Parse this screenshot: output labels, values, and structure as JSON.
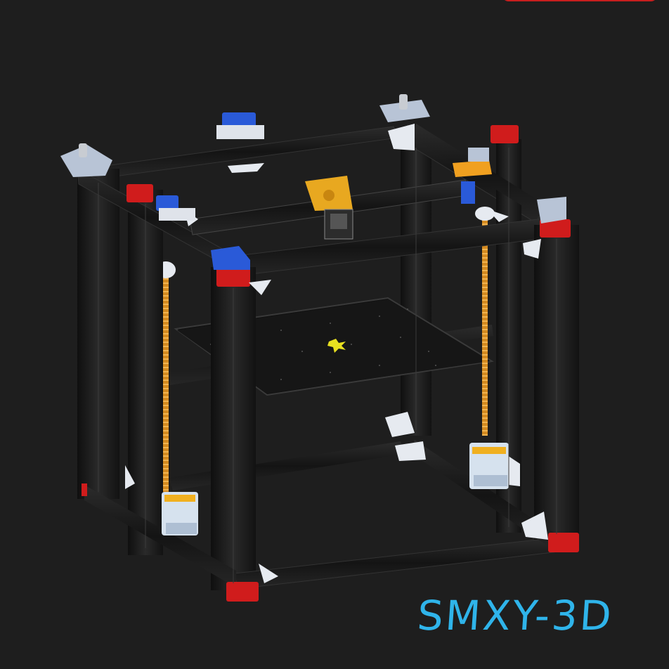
{
  "watermark": {
    "text": "SMXY-3D",
    "color": "#2fb4ea"
  },
  "colors": {
    "background": "#1e1e1e",
    "frame": "#1a1a1a",
    "corner_block": "#d01c1c",
    "leadscrew": "#e8a030",
    "bracket": "#e6eaf0",
    "carriage": "#f0b020",
    "mount_blue": "#2a5ad8"
  },
  "objects": [
    "3d-printer-frame",
    "print-bed",
    "stepper-motor",
    "lead-screw",
    "toolhead",
    "corner-bracket"
  ]
}
